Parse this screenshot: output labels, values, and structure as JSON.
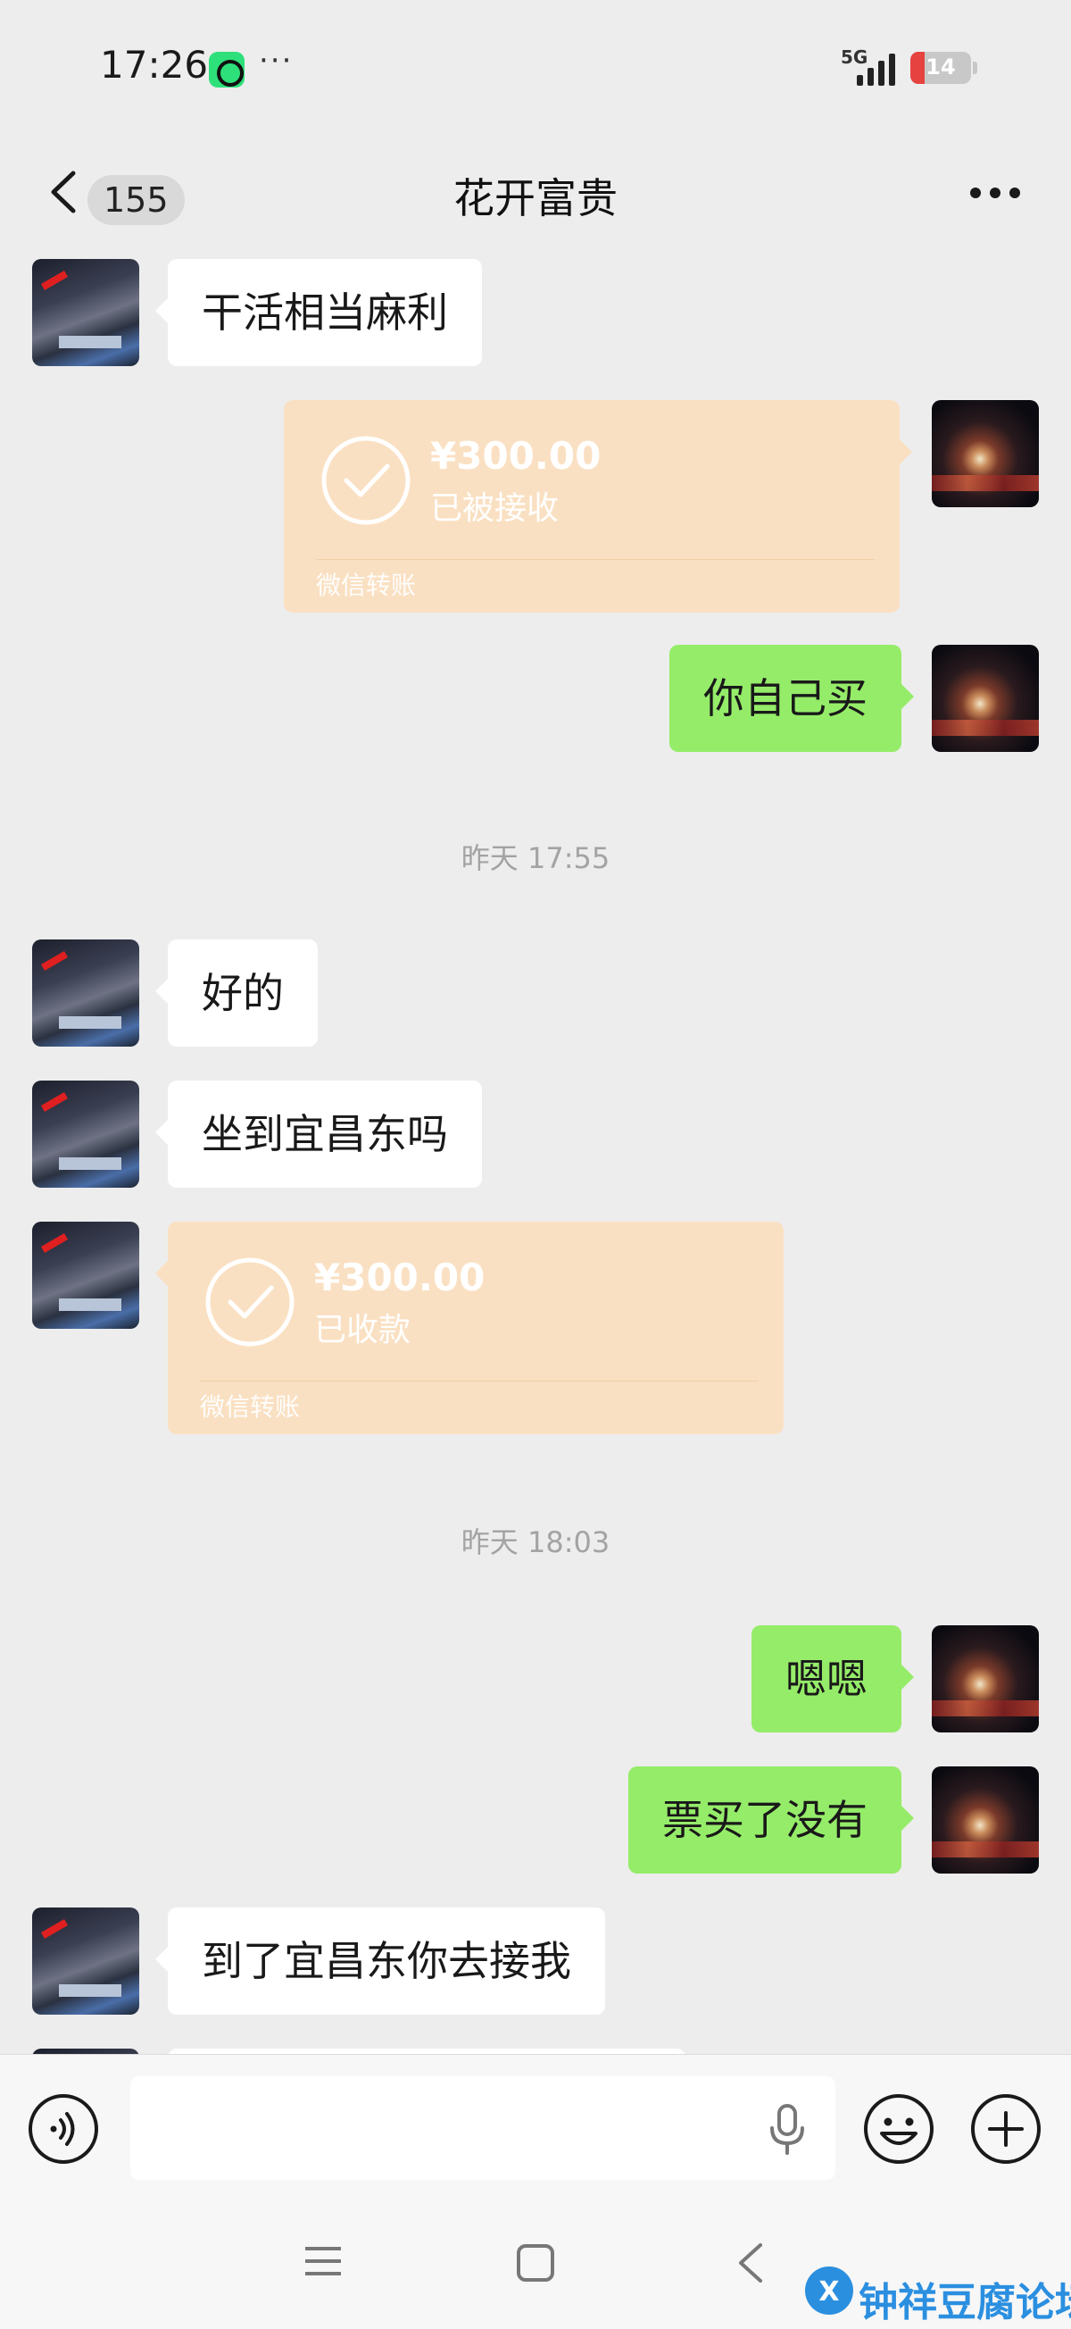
{
  "status_bar": {
    "time": "17:26",
    "dots": "···",
    "network": "5G",
    "battery": "14"
  },
  "header": {
    "unread_count": "155",
    "title": "花开富贵"
  },
  "messages": {
    "m1": "干活相当麻利",
    "transfer1": {
      "amount": "¥300.00",
      "status": "已被接收",
      "label": "微信转账"
    },
    "m2": "你自己买",
    "ts1": "昨天 17:55",
    "m3": "好的",
    "m4": "坐到宜昌东吗",
    "transfer2": {
      "amount": "¥300.00",
      "status": "已收款",
      "label": "微信转账"
    },
    "ts2": "昨天 18:03",
    "m5": "嗯嗯",
    "m6": "票买了没有",
    "m7": "到了宜昌东你去接我"
  },
  "watermark": "钟祥豆腐论坛",
  "colors": {
    "sent_bubble": "#95ec69",
    "received_bubble": "#ffffff",
    "transfer_card": "#fae0c2",
    "background": "#ededed"
  }
}
